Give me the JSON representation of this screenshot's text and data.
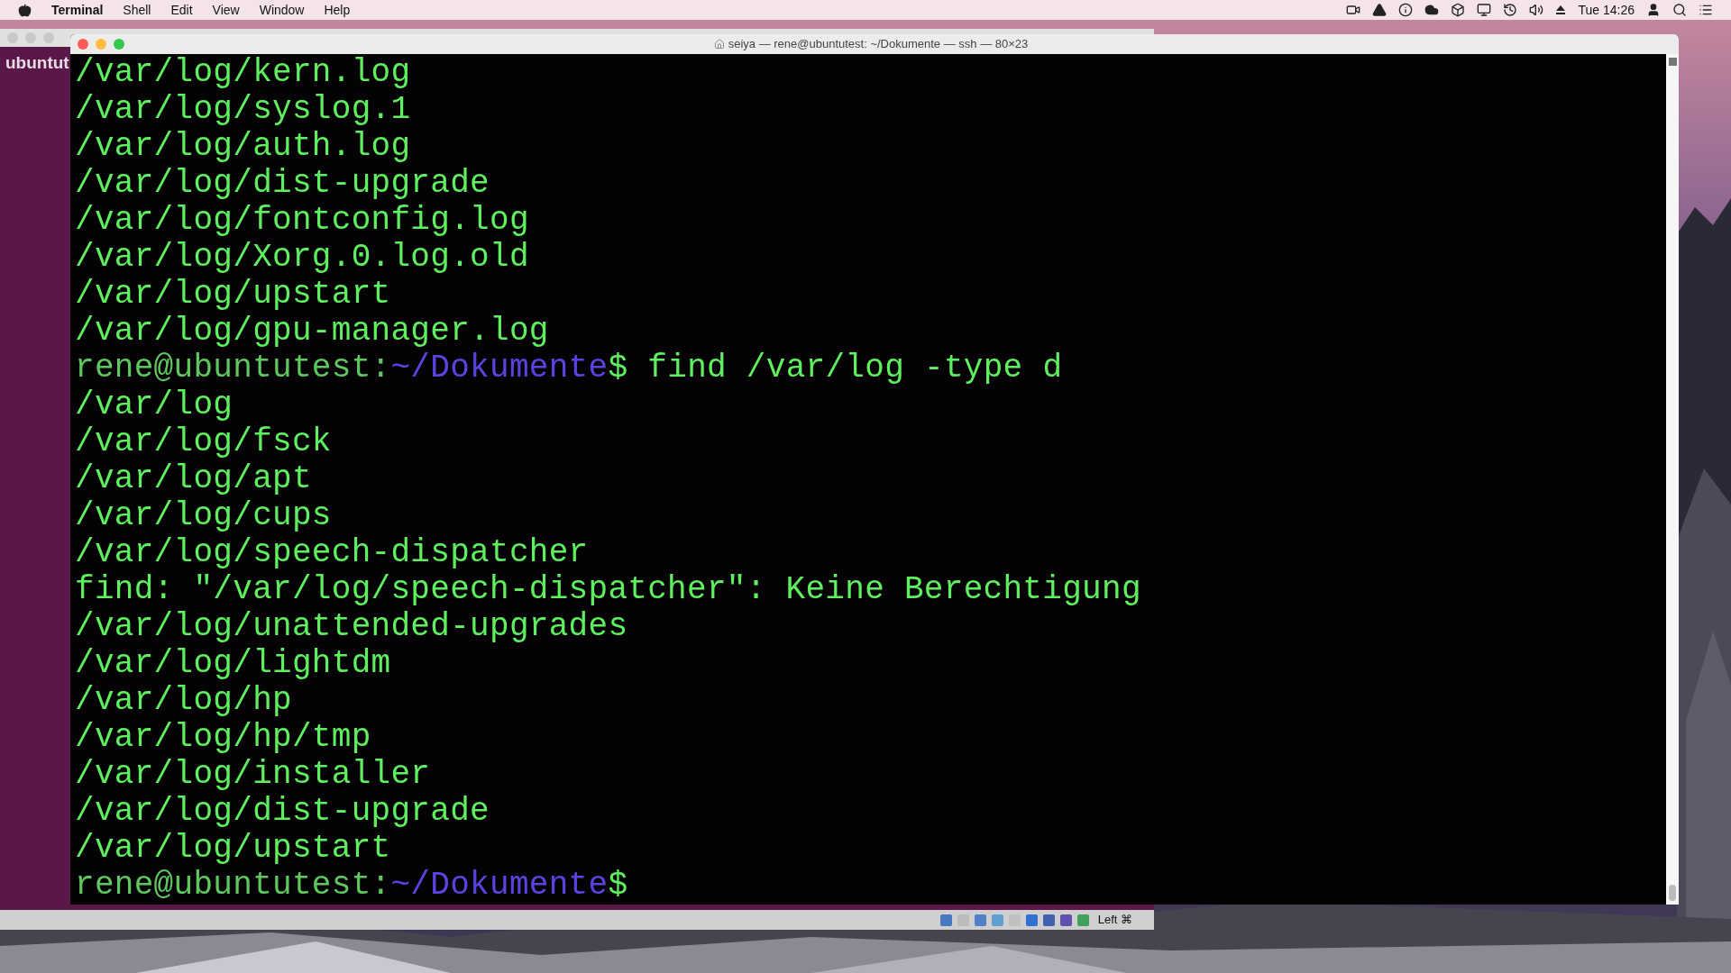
{
  "menu_bar": {
    "app": "Terminal",
    "menus": [
      "Shell",
      "Edit",
      "View",
      "Window",
      "Help"
    ],
    "clock": "Tue 14:26"
  },
  "background_window": {
    "sidebar_label": "ubuntut",
    "status_text": "Left ⌘"
  },
  "terminal": {
    "title": "seiya — rene@ubuntutest: ~/Dokumente — ssh — 80×23",
    "lines": [
      {
        "kind": "output",
        "text": "/var/log/kern.log"
      },
      {
        "kind": "output",
        "text": "/var/log/syslog.1"
      },
      {
        "kind": "output",
        "text": "/var/log/auth.log"
      },
      {
        "kind": "output",
        "text": "/var/log/dist-upgrade"
      },
      {
        "kind": "output",
        "text": "/var/log/fontconfig.log"
      },
      {
        "kind": "output",
        "text": "/var/log/Xorg.0.log.old"
      },
      {
        "kind": "output",
        "text": "/var/log/upstart"
      },
      {
        "kind": "output",
        "text": "/var/log/gpu-manager.log"
      },
      {
        "kind": "prompt",
        "user": "rene@ubuntutest:",
        "path": "~/Dokumente",
        "symbol": "$",
        "command": "find /var/log -type d"
      },
      {
        "kind": "output",
        "text": "/var/log"
      },
      {
        "kind": "output",
        "text": "/var/log/fsck"
      },
      {
        "kind": "output",
        "text": "/var/log/apt"
      },
      {
        "kind": "output",
        "text": "/var/log/cups"
      },
      {
        "kind": "output",
        "text": "/var/log/speech-dispatcher"
      },
      {
        "kind": "output",
        "text": "find: \"/var/log/speech-dispatcher\": Keine Berechtigung"
      },
      {
        "kind": "output",
        "text": "/var/log/unattended-upgrades"
      },
      {
        "kind": "output",
        "text": "/var/log/lightdm"
      },
      {
        "kind": "output",
        "text": "/var/log/hp"
      },
      {
        "kind": "output",
        "text": "/var/log/hp/tmp"
      },
      {
        "kind": "output",
        "text": "/var/log/installer"
      },
      {
        "kind": "output",
        "text": "/var/log/dist-upgrade"
      },
      {
        "kind": "output",
        "text": "/var/log/upstart"
      },
      {
        "kind": "prompt",
        "user": "rene@ubuntutest:",
        "path": "~/Dokumente",
        "symbol": "$"
      }
    ]
  }
}
